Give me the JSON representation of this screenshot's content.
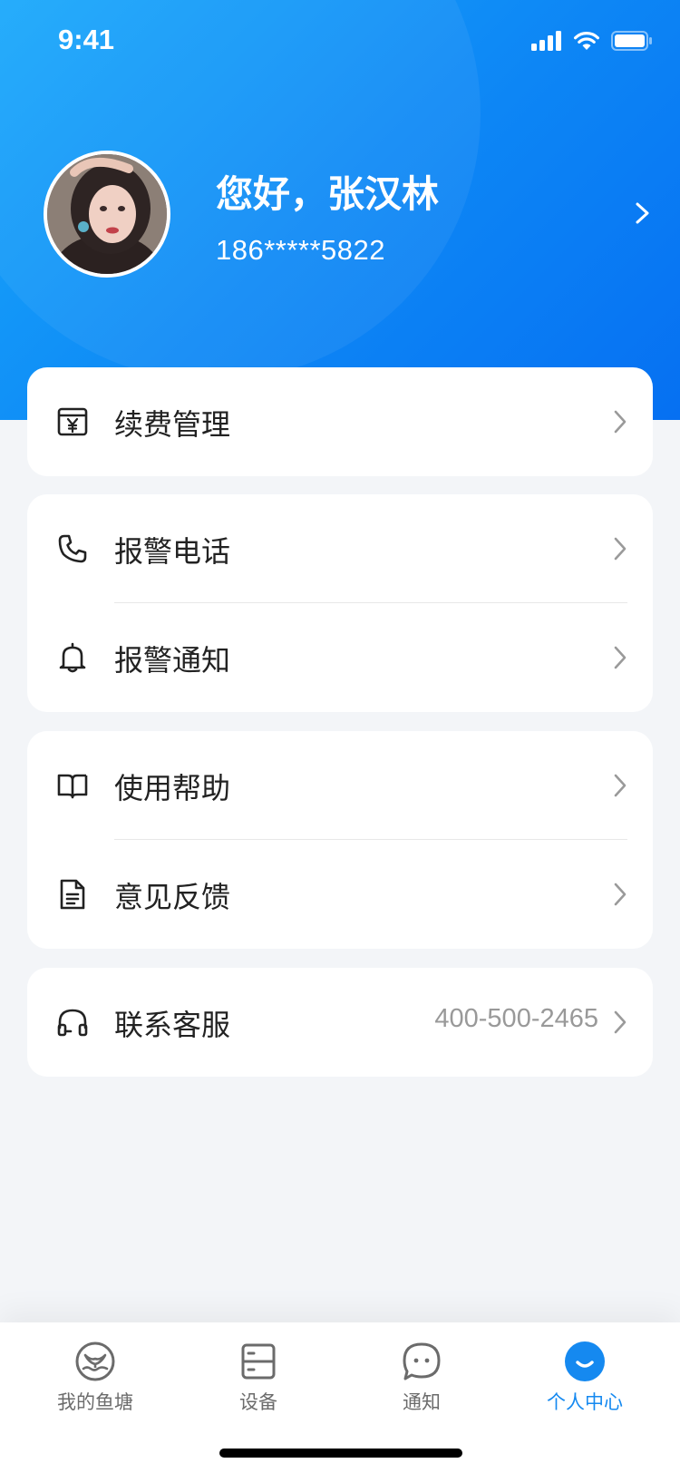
{
  "status_bar": {
    "time": "9:41",
    "icons": [
      "signal-icon",
      "wifi-icon",
      "battery-icon"
    ]
  },
  "profile": {
    "greeting": "您好，张汉林",
    "phone": "186*****5822",
    "avatar": "avatar",
    "chevron_icon": "chevron-right-icon"
  },
  "menu": {
    "renewal": {
      "label": "续费管理",
      "icon": "yuan-box-icon"
    },
    "alarm_phone": {
      "label": "报警电话",
      "icon": "phone-icon"
    },
    "alarm_notify": {
      "label": "报警通知",
      "icon": "bell-icon"
    },
    "help": {
      "label": "使用帮助",
      "icon": "book-icon"
    },
    "feedback": {
      "label": "意见反馈",
      "icon": "document-icon"
    },
    "service": {
      "label": "联系客服",
      "icon": "headset-icon",
      "value": "400-500-2465"
    }
  },
  "tabbar": {
    "tabs": [
      {
        "label": "我的鱼塘",
        "icon": "fish-pond-icon",
        "active": false
      },
      {
        "label": "设备",
        "icon": "device-icon",
        "active": false
      },
      {
        "label": "通知",
        "icon": "chat-bubble-icon",
        "active": false
      },
      {
        "label": "个人中心",
        "icon": "smile-icon",
        "active": true
      }
    ]
  },
  "colors": {
    "accent": "#1589f0",
    "header_start": "#19a8fb",
    "header_end": "#0670f2",
    "background": "#f3f5f8"
  }
}
